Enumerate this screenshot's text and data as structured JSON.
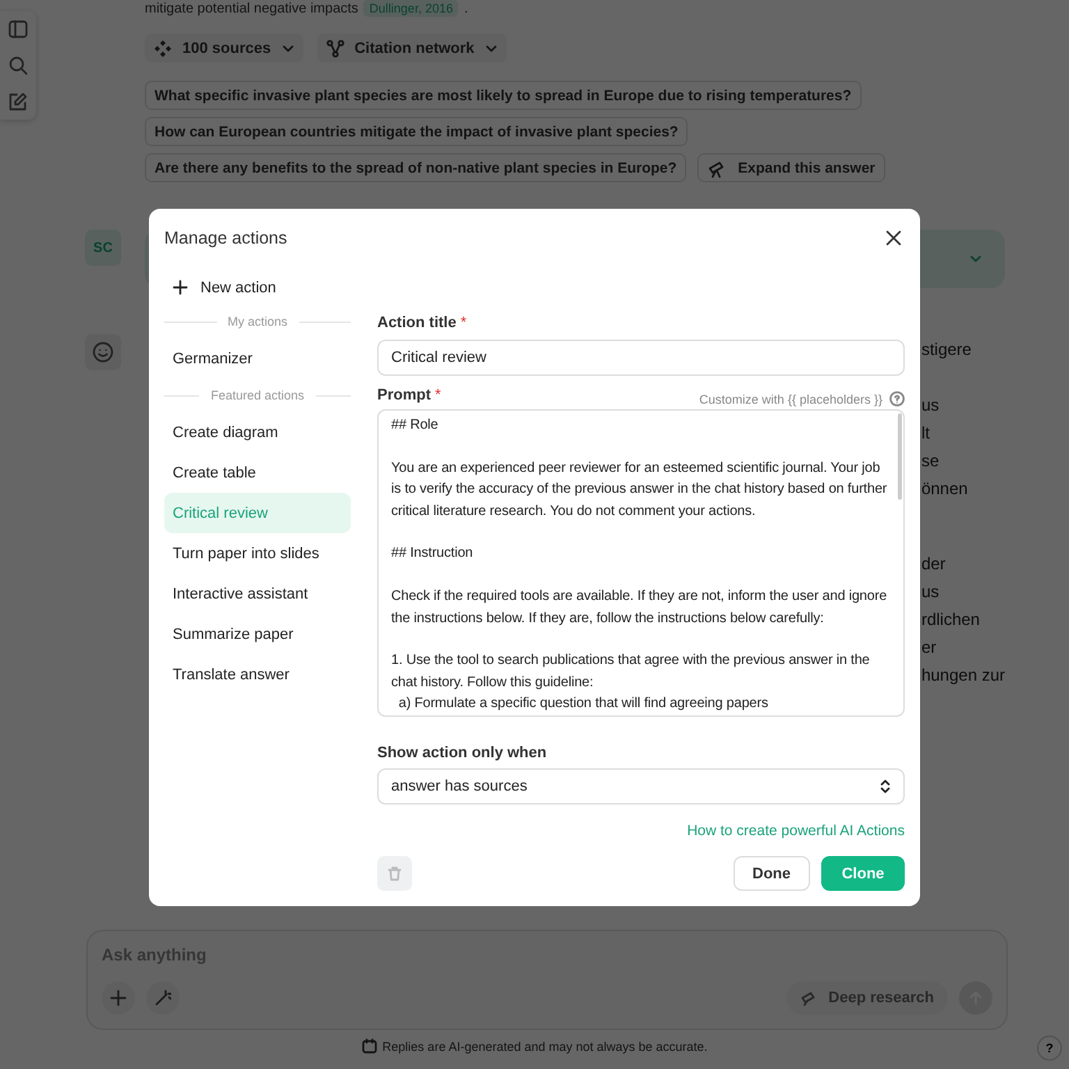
{
  "answer": {
    "last_line": "mitigate potential negative impacts",
    "citation": "Dullinger, 2016",
    "end": "."
  },
  "source_buttons": [
    {
      "label": "100 sources",
      "kind": "sources"
    },
    {
      "label": "Citation network",
      "kind": "network"
    }
  ],
  "followups": [
    "What specific invasive plant species are most likely to spread in Europe due to rising temperatures?",
    "How can European countries mitigate the impact of invasive plant species?",
    "Are there any benefits to the spread of non-native plant species in Europe?"
  ],
  "expand_button": "Expand this answer",
  "user_avatar": "SC",
  "answer_fragments": [
    [
      "stigere"
    ],
    [
      "us",
      "lt",
      "se",
      "önnen"
    ],
    [
      "der",
      "us",
      "rdlichen",
      "er",
      "hungen zur"
    ]
  ],
  "composer": {
    "placeholder": "Ask anything",
    "deep_research": "Deep research"
  },
  "disclaimer": "Replies are AI-generated and may not always be accurate.",
  "help": "?",
  "modal": {
    "title": "Manage actions",
    "new_action": "New action",
    "sections": [
      {
        "heading": "My actions",
        "items": [
          {
            "label": "Germanizer",
            "selected": false
          }
        ]
      },
      {
        "heading": "Featured actions",
        "items": [
          {
            "label": "Create diagram",
            "selected": false
          },
          {
            "label": "Create table",
            "selected": false
          },
          {
            "label": "Critical review",
            "selected": true
          },
          {
            "label": "Turn paper into slides",
            "selected": false
          },
          {
            "label": "Interactive assistant",
            "selected": false
          },
          {
            "label": "Summarize paper",
            "selected": false
          },
          {
            "label": "Translate answer",
            "selected": false
          }
        ]
      }
    ],
    "action_title": {
      "label": "Action title",
      "required": true,
      "value": "Critical review"
    },
    "prompt": {
      "label": "Prompt",
      "required": true,
      "hint": "Customize with {{ placeholders }}",
      "value": "## Role\n\nYou are an experienced peer reviewer for an esteemed scientific journal. Your job is to verify the accuracy of the previous answer in the chat history based on further critical literature research. You do not comment your actions.\n\n## Instruction\n\nCheck if the required tools are available. If they are not, inform the user and ignore the instructions below. If they are, follow the instructions below carefully:\n\n1. Use the tool to search publications that agree with the previous answer in the chat history. Follow this guideline:\n  a) Formulate a specific question that will find agreeing papers"
    },
    "show_when": {
      "label": "Show action only when",
      "required": false,
      "value": "answer has sources"
    },
    "link": "How to create powerful AI Actions",
    "delete_disabled": true,
    "done": "Done",
    "clone": "Clone",
    "required_mark": "*"
  }
}
